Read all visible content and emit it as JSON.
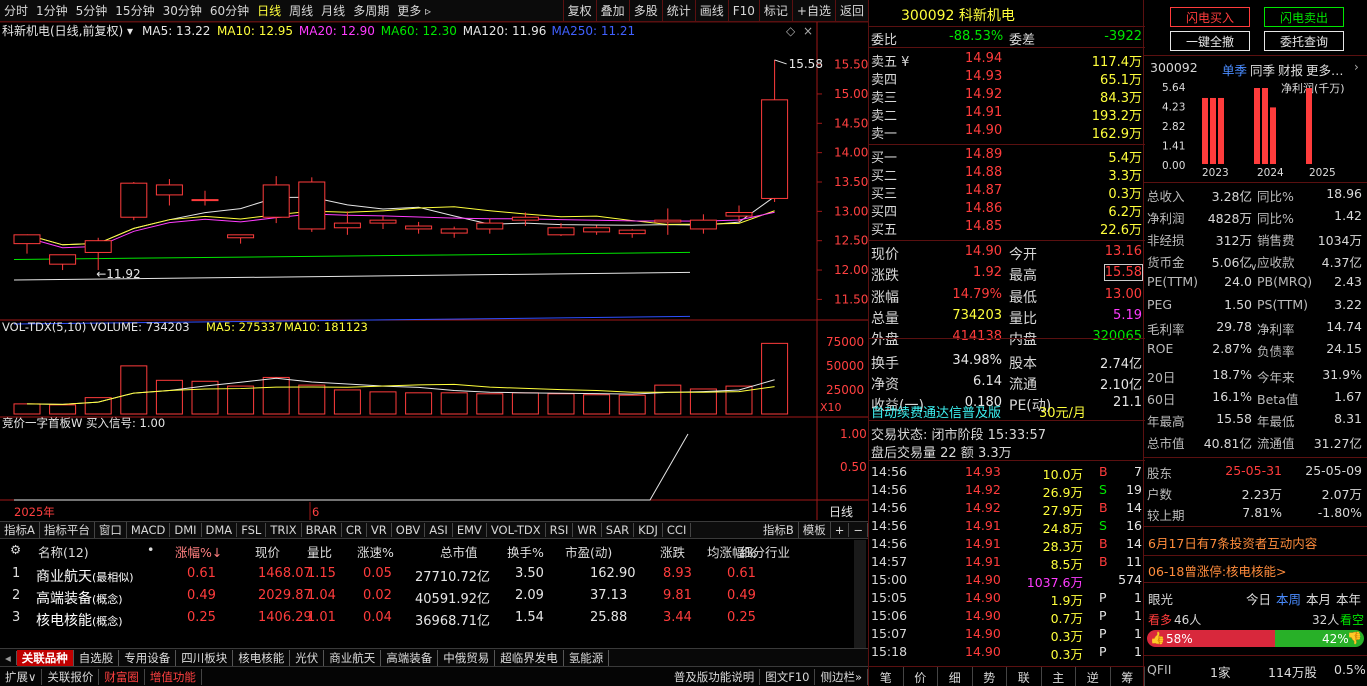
{
  "toolbar": {
    "periods": [
      "分时",
      "1分钟",
      "5分钟",
      "15分钟",
      "30分钟",
      "60分钟",
      "日线",
      "周线",
      "月线",
      "多周期",
      "更多"
    ],
    "tools": [
      "复权",
      "叠加",
      "多股",
      "统计",
      "画线",
      "F10",
      "标记",
      "+自选",
      "返回"
    ]
  },
  "chart": {
    "legend_title": "科新机电(日线,前复权)",
    "ma_labels": [
      {
        "t": "MA5: 13.22",
        "c": "#e6e6e6"
      },
      {
        "t": "MA10: 12.95",
        "c": "#ffff3c"
      },
      {
        "t": "MA20: 12.90",
        "c": "#ff3cff"
      },
      {
        "t": "MA60: 12.30",
        "c": "#00e600"
      },
      {
        "t": "MA120: 11.96",
        "c": "#e6e6e6"
      },
      {
        "t": "MA250: 11.21",
        "c": "#4060ff"
      }
    ],
    "price_ticks": [
      "15.50",
      "15.00",
      "14.50",
      "14.00",
      "13.50",
      "13.00",
      "12.50",
      "12.00",
      "11.50"
    ],
    "high_label": "15.58",
    "low_label": "11.92",
    "vol_legend": [
      "VOL-TDX(5,10)",
      "VOLUME: 734203",
      "MA5: 275337",
      "MA10: 181123"
    ],
    "vol_ticks": [
      "75000",
      "50000",
      "25000"
    ],
    "vol_unit": "X10",
    "ind_legend": "竞价一字首板W  买入信号: 1.00",
    "ind_ticks": [
      "1.00",
      "0.50"
    ],
    "date_labels": [
      "2025年",
      "6"
    ],
    "period_label": "日线"
  },
  "chart_data": {
    "type": "candlestick",
    "title": "科新机电(日线,前复权)",
    "candles": [
      [
        12.45,
        12.6,
        12.28,
        12.45
      ],
      [
        12.1,
        12.26,
        12.0,
        12.1
      ],
      [
        12.3,
        12.5,
        12.0,
        12.55
      ],
      [
        12.9,
        13.48,
        12.85,
        13.5
      ],
      [
        13.28,
        13.45,
        13.1,
        13.55
      ],
      [
        13.2,
        13.2,
        13.1,
        13.35
      ],
      [
        12.55,
        12.6,
        12.45,
        12.58
      ],
      [
        12.9,
        13.45,
        12.8,
        13.6
      ],
      [
        12.7,
        13.5,
        12.65,
        13.58
      ],
      [
        12.72,
        12.8,
        12.6,
        13.0
      ],
      [
        12.8,
        12.85,
        12.7,
        12.92
      ],
      [
        12.7,
        12.75,
        12.62,
        12.82
      ],
      [
        12.63,
        12.7,
        12.55,
        12.74
      ],
      [
        12.7,
        12.8,
        12.62,
        12.88
      ],
      [
        12.85,
        12.9,
        12.75,
        12.98
      ],
      [
        12.6,
        12.72,
        12.58,
        12.8
      ],
      [
        12.65,
        12.72,
        12.6,
        12.76
      ],
      [
        12.62,
        12.68,
        12.55,
        12.7
      ],
      [
        12.82,
        12.85,
        12.6,
        13.05
      ],
      [
        12.7,
        12.85,
        12.62,
        12.95
      ],
      [
        12.92,
        12.98,
        12.82,
        13.1
      ],
      [
        13.22,
        14.9,
        13.16,
        15.58
      ]
    ],
    "volumes": [
      10500,
      9500,
      17000,
      50000,
      35000,
      34000,
      29000,
      38000,
      30000,
      25000,
      23000,
      22000,
      22000,
      21000,
      22000,
      21000,
      20000,
      19500,
      30000,
      26000,
      29000,
      73400
    ]
  },
  "ind_bar": {
    "items": [
      "指标A",
      "指标平台",
      "窗口",
      "MACD",
      "DMI",
      "DMA",
      "FSL",
      "TRIX",
      "BRAR",
      "CR",
      "VR",
      "OBV",
      "ASI",
      "EMV",
      "VOL-TDX",
      "RSI",
      "WR",
      "SAR",
      "KDJ",
      "CCI"
    ],
    "right": [
      "指标B",
      "模板",
      "+",
      "−"
    ]
  },
  "related": {
    "headers": [
      "名称(12)",
      "涨幅%↓",
      "现价",
      "量比",
      "涨速%",
      "总市值",
      "换手%",
      "市盈(动)",
      "涨跌",
      "均涨幅%",
      "细分行业"
    ],
    "rows": [
      [
        "1",
        "商业航天",
        "(最相似)",
        "0.61",
        "1468.07",
        "1.15",
        "0.05",
        "27710.72亿",
        "3.50",
        "162.90",
        "8.93",
        "0.61"
      ],
      [
        "2",
        "高端装备",
        "(概念)",
        "0.49",
        "2029.87",
        "1.04",
        "0.02",
        "40591.92亿",
        "2.09",
        "37.13",
        "9.81",
        "0.49"
      ],
      [
        "3",
        "核电核能",
        "(概念)",
        "0.25",
        "1406.29",
        "1.01",
        "0.04",
        "36968.71亿",
        "1.54",
        "25.88",
        "3.44",
        "0.25"
      ]
    ]
  },
  "tabs": [
    "关联品种",
    "自选股",
    "专用设备",
    "四川板块",
    "核电核能",
    "光伏",
    "商业航天",
    "高端装备",
    "中俄贸易",
    "超临界发电",
    "氢能源"
  ],
  "bottom": {
    "left": [
      "扩展∨",
      "关联报价",
      "财富圈",
      "增值功能"
    ],
    "right": [
      "普及版功能说明",
      "图文F10",
      "侧边栏»"
    ],
    "corner": "自选股"
  },
  "quote": {
    "code": "300092",
    "name": "科新机电",
    "weibi_l": "委比",
    "weibi": "-88.53%",
    "weicha_l": "委差",
    "weicha": "-3922",
    "sells": [
      [
        "卖五",
        "14.94",
        "117.4万"
      ],
      [
        "卖四",
        "14.93",
        "65.1万"
      ],
      [
        "卖三",
        "14.92",
        "84.3万"
      ],
      [
        "卖二",
        "14.91",
        "193.2万"
      ],
      [
        "卖一",
        "14.90",
        "162.9万"
      ]
    ],
    "buys": [
      [
        "买一",
        "14.89",
        "5.4万"
      ],
      [
        "买二",
        "14.88",
        "3.3万"
      ],
      [
        "买三",
        "14.87",
        "0.3万"
      ],
      [
        "买四",
        "14.86",
        "6.2万"
      ],
      [
        "买五",
        "14.85",
        "22.6万"
      ]
    ],
    "stats": [
      [
        "现价",
        "14.90",
        "red",
        "今开",
        "13.16",
        "red"
      ],
      [
        "涨跌",
        "1.92",
        "red",
        "最高",
        "15.58",
        "red"
      ],
      [
        "涨幅",
        "14.79%",
        "red",
        "最低",
        "13.00",
        "red"
      ],
      [
        "总量",
        "734203",
        "yellow",
        "量比",
        "5.19",
        "mag"
      ],
      [
        "外盘",
        "414138",
        "red",
        "内盘",
        "320065",
        "green"
      ],
      [
        "换手",
        "34.98%",
        "white",
        "股本",
        "2.74亿",
        "white"
      ],
      [
        "净资",
        "6.14",
        "white",
        "流通",
        "2.10亿",
        "white"
      ],
      [
        "收益(一)",
        "0.180",
        "white",
        "PE(动)",
        "21.1",
        "white"
      ]
    ],
    "ad": "自动续费通达信普及版",
    "ad_price": "30元/月",
    "trade_state": "交易状态: 闭市阶段 15:33:57",
    "after": "盘后交易量 22 额 3.3万",
    "ticks": [
      [
        "14:56",
        "14.93",
        "10.0万",
        "B",
        "7"
      ],
      [
        "14:56",
        "14.92",
        "26.9万",
        "S",
        "19"
      ],
      [
        "14:56",
        "14.92",
        "27.9万",
        "B",
        "14"
      ],
      [
        "14:56",
        "14.91",
        "24.8万",
        "S",
        "16"
      ],
      [
        "14:56",
        "14.91",
        "28.3万",
        "B",
        "14"
      ],
      [
        "14:57",
        "14.91",
        "8.5万",
        "B",
        "11"
      ],
      [
        "15:00",
        "14.90",
        "1037.6万",
        "",
        "574"
      ],
      [
        "15:05",
        "14.90",
        "1.9万",
        "P",
        "1"
      ],
      [
        "15:06",
        "14.90",
        "0.7万",
        "P",
        "1"
      ],
      [
        "15:07",
        "14.90",
        "0.3万",
        "P",
        "1"
      ],
      [
        "15:18",
        "14.90",
        "0.3万",
        "P",
        "1"
      ]
    ],
    "mid_tabs": [
      "笔",
      "价",
      "细",
      "势",
      "联",
      "主",
      "逆",
      "筹"
    ]
  },
  "right": {
    "buttons": [
      "闪电买入",
      "闪电卖出",
      "一键全撤",
      "委托查询"
    ],
    "code": "300092",
    "fin_tabs": [
      "单季",
      "同季",
      "财报",
      "更多"
    ],
    "bar_chart": {
      "title": "净利润(千万)",
      "yticks": [
        "5.64",
        "4.23",
        "2.82",
        "1.41",
        "0.00"
      ],
      "xlabels": [
        "2023",
        "2024",
        "2025"
      ],
      "values": [
        4.9,
        4.9,
        4.9,
        5.64,
        5.64,
        4.2,
        5.64
      ]
    },
    "fund": [
      [
        "总收入",
        "3.28亿",
        "同比%",
        "18.96"
      ],
      [
        "净利润",
        "4828万",
        "同比%",
        "1.42"
      ],
      [
        "非经损",
        "312万",
        "销售费",
        "1034万"
      ],
      [
        "货币金",
        "5.06亿",
        "应收款",
        "4.37亿"
      ],
      [
        "PE(TTM)",
        "24.0",
        "PB(MRQ)",
        "2.43"
      ],
      [
        "PEG",
        "1.50",
        "PS(TTM)",
        "3.22"
      ],
      [
        "毛利率",
        "29.78",
        "净利率",
        "14.74"
      ],
      [
        "ROE",
        "2.87%",
        "负债率",
        "24.15"
      ],
      [
        "20日",
        "18.7%",
        "今年来",
        "31.9%"
      ],
      [
        "60日",
        "16.1%",
        "Beta值",
        "1.67"
      ],
      [
        "年最高",
        "15.58",
        "年最低",
        "8.31"
      ],
      [
        "总市值",
        "40.81亿",
        "流通值",
        "31.27亿"
      ]
    ],
    "holders": [
      [
        "股东",
        "25-05-31",
        "25-05-09"
      ],
      [
        "户数",
        "2.23万",
        "2.07万"
      ],
      [
        "较上期",
        "7.81%",
        "-1.80%"
      ]
    ],
    "news": [
      "6月17日有7条投资者互动内容",
      "06-18曾涨停:核电核能>"
    ],
    "eye": {
      "label": "眼光",
      "tabs": [
        "今日",
        "本周",
        "本月",
        "本年"
      ],
      "bear_l": "看多",
      "bear_n": "46人",
      "bull_n": "32人",
      "bull_l": "看空",
      "up_pct": "58%",
      "down_pct": "42%"
    },
    "qfii": [
      "QFII",
      "1家",
      "114万股",
      "0.5%"
    ]
  }
}
